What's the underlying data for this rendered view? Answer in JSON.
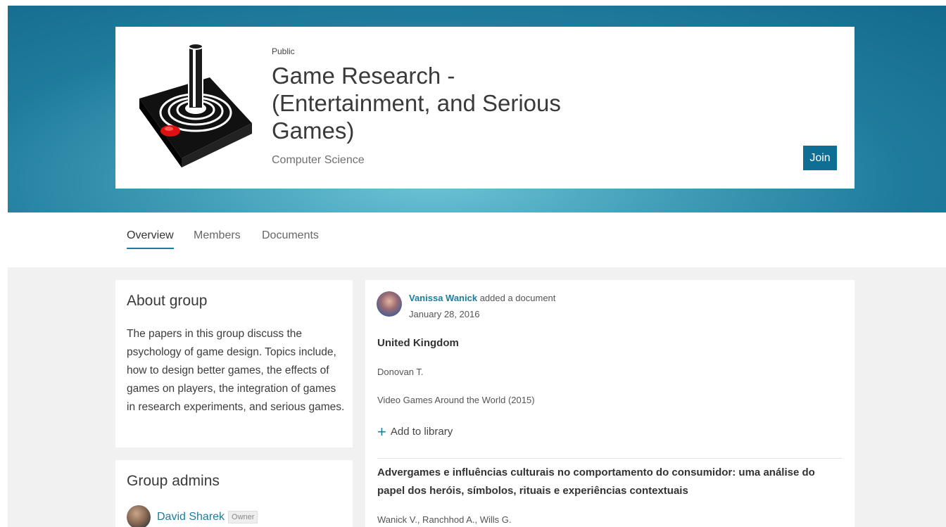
{
  "group": {
    "visibility": "Public",
    "title": "Game Research - (Entertainment, and Serious Games)",
    "discipline": "Computer Science",
    "join_label": "Join"
  },
  "tabs": [
    {
      "label": "Overview",
      "active": true
    },
    {
      "label": "Members",
      "active": false
    },
    {
      "label": "Documents",
      "active": false
    }
  ],
  "about": {
    "heading": "About group",
    "description": "The papers in this group discuss the psychology of game design. Topics include, how to design better games, the effects of games on players, the integration of games in research experiments, and serious games."
  },
  "admins": {
    "heading": "Group admins",
    "list": [
      {
        "name": "David Sharek",
        "role": "Owner"
      }
    ]
  },
  "activity": {
    "user": "Vanissa Wanick",
    "action": "added a document",
    "date": "January 28, 2016",
    "documents": [
      {
        "title": "United Kingdom",
        "authors": "Donovan T.",
        "source": "Video Games Around the World (2015)",
        "add_label": "Add to library"
      },
      {
        "title": "Advergames e influências culturais no comportamento do consumidor: uma análise do papel dos heróis, símbolos, rituais e experiências contextuais",
        "authors": "Wanick V., Ranchhod A., Wills G."
      }
    ]
  },
  "colors": {
    "accent": "#1f7b9c",
    "join_button": "#0f6e93",
    "hero_light": "#6cc3d6",
    "hero_dark": "#136a8c"
  },
  "icons": [
    "joystick-logo-icon",
    "plus-icon"
  ]
}
